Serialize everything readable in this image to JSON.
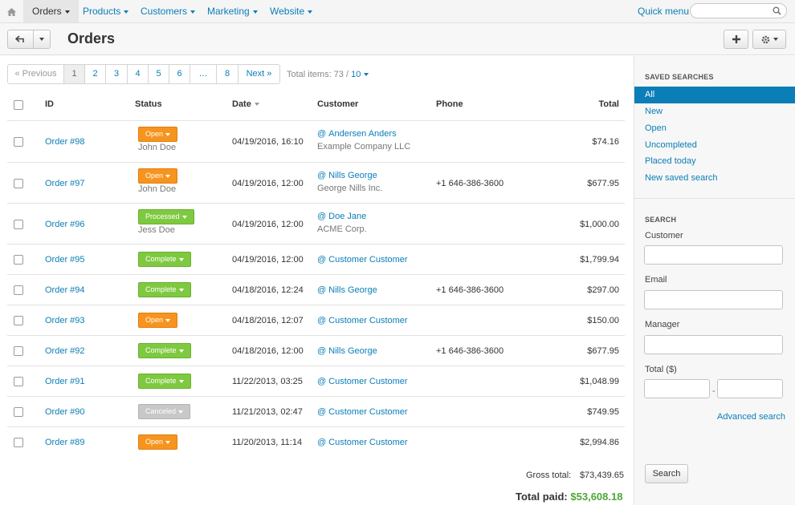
{
  "nav": {
    "items": [
      {
        "label": "Orders",
        "active": true
      },
      {
        "label": "Products",
        "active": false
      },
      {
        "label": "Customers",
        "active": false
      },
      {
        "label": "Marketing",
        "active": false
      },
      {
        "label": "Website",
        "active": false
      }
    ],
    "quick_menu": "Quick menu",
    "search_placeholder": ""
  },
  "page": {
    "title": "Orders"
  },
  "pager": {
    "items": [
      "« Previous",
      "1",
      "2",
      "3",
      "4",
      "5",
      "6",
      "…",
      "8",
      "Next »"
    ],
    "total_label": "Total items: 73 / ",
    "per_page": "10"
  },
  "table": {
    "headers": {
      "id": "ID",
      "status": "Status",
      "date": "Date",
      "customer": "Customer",
      "phone": "Phone",
      "total": "Total"
    },
    "rows": [
      {
        "id": "Order #98",
        "status": "Open",
        "status_type": "open",
        "manager": "John Doe",
        "date": "04/19/2016, 16:10",
        "customer": "Andersen Anders",
        "company": "Example Company LLC",
        "phone": "",
        "total": "$74.16"
      },
      {
        "id": "Order #97",
        "status": "Open",
        "status_type": "open",
        "manager": "John Doe",
        "date": "04/19/2016, 12:00",
        "customer": "Nills George",
        "company": "George Nills Inc.",
        "phone": "+1 646-386-3600",
        "total": "$677.95"
      },
      {
        "id": "Order #96",
        "status": "Processed",
        "status_type": "proc",
        "manager": "Jess Doe",
        "date": "04/19/2016, 12:00",
        "customer": "Doe Jane",
        "company": "ACME Corp.",
        "phone": "",
        "total": "$1,000.00"
      },
      {
        "id": "Order #95",
        "status": "Complete",
        "status_type": "proc",
        "manager": "",
        "date": "04/19/2016, 12:00",
        "customer": "Customer Customer",
        "company": "",
        "phone": "",
        "total": "$1,799.94"
      },
      {
        "id": "Order #94",
        "status": "Complete",
        "status_type": "proc",
        "manager": "",
        "date": "04/18/2016, 12:24",
        "customer": "Nills George",
        "company": "",
        "phone": "+1 646-386-3600",
        "total": "$297.00"
      },
      {
        "id": "Order #93",
        "status": "Open",
        "status_type": "open",
        "manager": "",
        "date": "04/18/2016, 12:07",
        "customer": "Customer Customer",
        "company": "",
        "phone": "",
        "total": "$150.00"
      },
      {
        "id": "Order #92",
        "status": "Complete",
        "status_type": "proc",
        "manager": "",
        "date": "04/18/2016, 12:00",
        "customer": "Nills George",
        "company": "",
        "phone": "+1 646-386-3600",
        "total": "$677.95"
      },
      {
        "id": "Order #91",
        "status": "Complete",
        "status_type": "proc",
        "manager": "",
        "date": "11/22/2013, 03:25",
        "customer": "Customer Customer",
        "company": "",
        "phone": "",
        "total": "$1,048.99"
      },
      {
        "id": "Order #90",
        "status": "Canceled",
        "status_type": "canc",
        "manager": "",
        "date": "11/21/2013, 02:47",
        "customer": "Customer Customer",
        "company": "",
        "phone": "",
        "total": "$749.95"
      },
      {
        "id": "Order #89",
        "status": "Open",
        "status_type": "open",
        "manager": "",
        "date": "11/20/2013, 11:14",
        "customer": "Customer Customer",
        "company": "",
        "phone": "",
        "total": "$2,994.86"
      }
    ]
  },
  "totals": {
    "gross_label": "Gross total:",
    "gross_value": "$73,439.65",
    "paid_label": "Total paid:",
    "paid_value": "$53,608.18"
  },
  "sidebar": {
    "saved_heading": "SAVED SEARCHES",
    "saved": [
      "All",
      "New",
      "Open",
      "Uncompleted",
      "Placed today",
      "New saved search"
    ],
    "search_heading": "SEARCH",
    "fields": {
      "customer": "Customer",
      "email": "Email",
      "manager": "Manager",
      "total": "Total ($)"
    },
    "range_sep": "-",
    "search_button": "Search",
    "advanced": "Advanced search"
  }
}
